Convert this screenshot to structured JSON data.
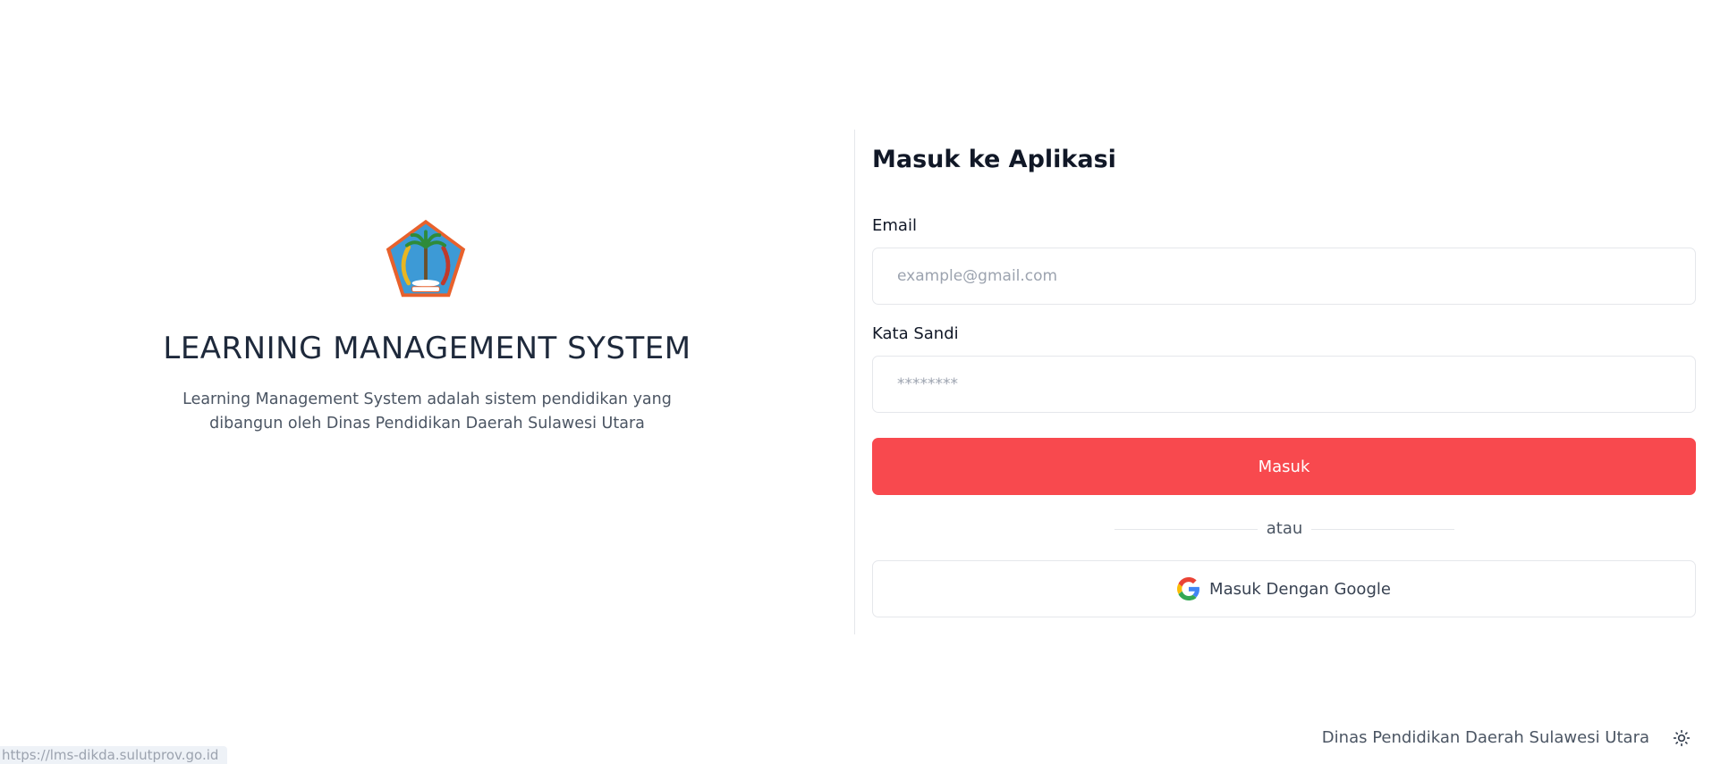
{
  "hero": {
    "logo": "sulawesi-utara-emblem",
    "title": "LEARNING MANAGEMENT SYSTEM",
    "description": "Learning Management System adalah sistem pendidikan yang dibangun oleh Dinas Pendidikan Daerah Sulawesi Utara"
  },
  "login": {
    "title": "Masuk ke Aplikasi",
    "email_label": "Email",
    "email_placeholder": "example@gmail.com",
    "password_label": "Kata Sandi",
    "password_placeholder": "********",
    "submit_label": "Masuk",
    "separator_text": "atau",
    "google_label": "Masuk Dengan Google",
    "google_icon": "google-g-icon"
  },
  "footer": {
    "text": "Dinas Pendidikan Daerah Sulawesi Utara",
    "theme_icon": "sun-icon"
  },
  "status_bar": {
    "url": "https://lms-dikda.sulutprov.go.id"
  },
  "colors": {
    "primary": "#f8494e",
    "border": "#e5e7eb",
    "heading": "#1e293b",
    "muted": "#4b5563",
    "placeholder": "#9ca3af"
  }
}
